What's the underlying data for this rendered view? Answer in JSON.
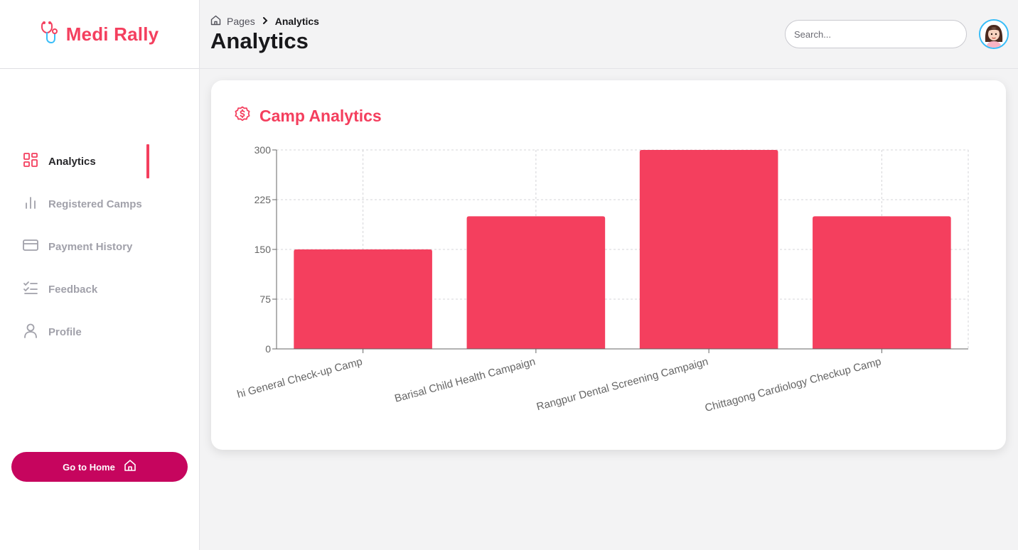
{
  "app": {
    "name": "Medi Rally"
  },
  "sidebar": {
    "items": [
      {
        "label": "Analytics",
        "icon": "grid-icon",
        "active": true
      },
      {
        "label": "Registered Camps",
        "icon": "bar-chart-icon",
        "active": false
      },
      {
        "label": "Payment History",
        "icon": "credit-card-icon",
        "active": false
      },
      {
        "label": "Feedback",
        "icon": "checklist-icon",
        "active": false
      },
      {
        "label": "Profile",
        "icon": "user-icon",
        "active": false
      }
    ],
    "home_button": "Go to Home"
  },
  "header": {
    "breadcrumb": {
      "root": "Pages",
      "current": "Analytics"
    },
    "title": "Analytics",
    "search_placeholder": "Search..."
  },
  "card": {
    "title": "Camp Analytics"
  },
  "colors": {
    "accent": "#f43f5e",
    "home_button": "#c6055e",
    "bar": "#f43f5e"
  },
  "chart_data": {
    "type": "bar",
    "categories": [
      "Rajshahi General Check-up Camp",
      "Barisal Child Health Campaign",
      "Rangpur Dental Screening Campaign",
      "Chittagong Cardiology Checkup Camp"
    ],
    "visible_first_label": "hi General Check-up Camp",
    "values": [
      150,
      200,
      300,
      200
    ],
    "yticks": [
      0,
      75,
      150,
      225,
      300
    ],
    "ylim": [
      0,
      300
    ],
    "grid": true
  }
}
